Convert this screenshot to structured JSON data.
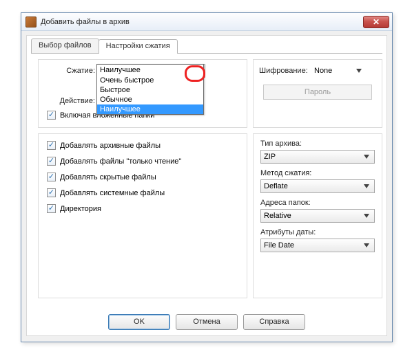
{
  "window": {
    "title": "Добавить файлы в архив"
  },
  "tabs": {
    "files": "Выбор файлов",
    "compression": "Настройки сжатия"
  },
  "top_left": {
    "compression_label": "Сжатие:",
    "compression_value": "Наилучшее",
    "action_label": "Действие:",
    "include_nested": "Включая вложенные папки"
  },
  "dropdown": {
    "item0": "Очень быстрое",
    "item1": "Быстрое",
    "item2": "Обычное",
    "item3": "Наилучшее"
  },
  "top_right": {
    "encryption_label": "Шифрование:",
    "encryption_value": "None",
    "password_btn": "Пароль"
  },
  "bot_left": {
    "c0": "Добавлять архивные файлы",
    "c1": "Добавлять файлы \"только чтение\"",
    "c2": "Добавлять скрытые файлы",
    "c3": "Добавлять системные файлы",
    "c4": "Директория"
  },
  "bot_right": {
    "type_label": "Тип архива:",
    "type_value": "ZIP",
    "method_label": "Метод сжатия:",
    "method_value": "Deflate",
    "folders_label": "Адреса папок:",
    "folders_value": "Relative",
    "date_label": "Атрибуты даты:",
    "date_value": "File Date"
  },
  "buttons": {
    "ok": "OK",
    "cancel": "Отмена",
    "help": "Справка"
  }
}
